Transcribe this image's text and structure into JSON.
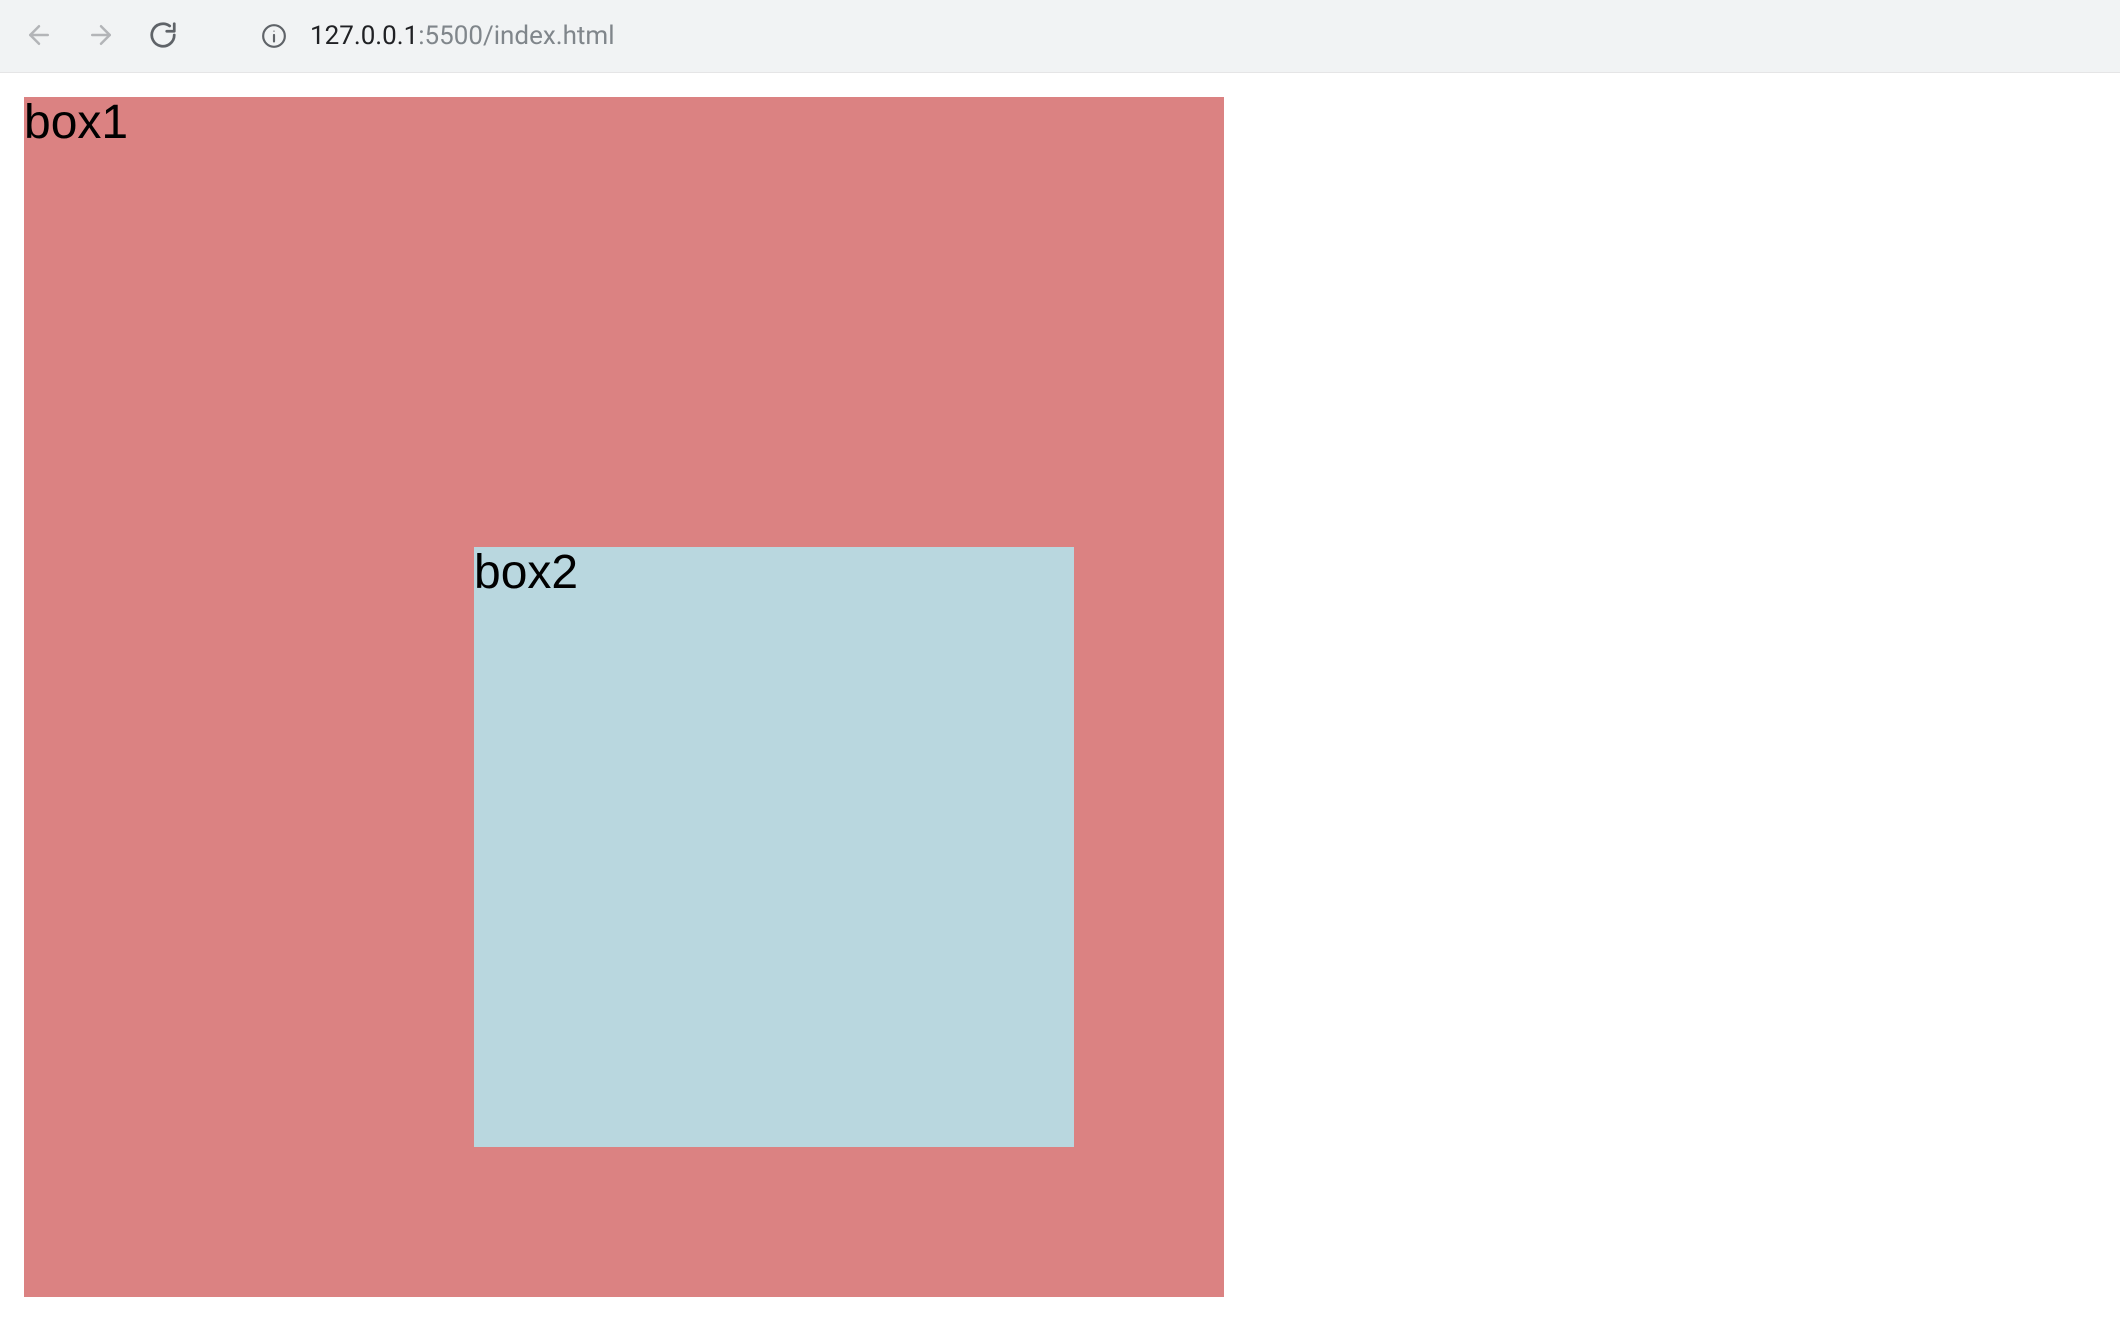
{
  "toolbar": {
    "url_host": "127.0.0.1",
    "url_port_path": ":5500/index.html"
  },
  "page": {
    "box1_label": "box1",
    "box2_label": "box2"
  },
  "colors": {
    "box1_bg": "#db8282",
    "box2_bg": "#b9d7df"
  }
}
